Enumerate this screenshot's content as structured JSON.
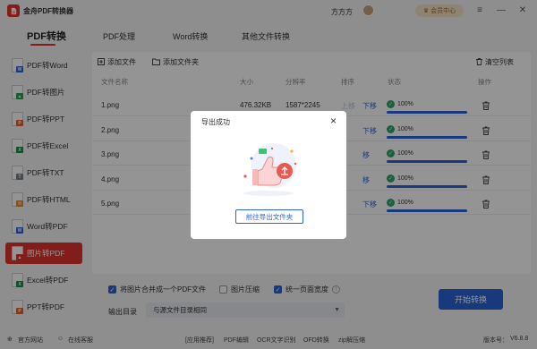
{
  "app": {
    "title": "金舟PDF转换器",
    "username": "方方方",
    "vip_label": "会员中心",
    "version_label": "版本号：",
    "version": "V6.8.8"
  },
  "nav": {
    "tabs": [
      "PDF转换",
      "PDF处理",
      "Word转换",
      "其他文件转换"
    ]
  },
  "sidebar": {
    "items": [
      {
        "label": "PDF转Word",
        "badge": "W",
        "color": "#2a64d8"
      },
      {
        "label": "PDF转图片",
        "badge": "▲",
        "color": "#26a05a"
      },
      {
        "label": "PDF转PPT",
        "badge": "P",
        "color": "#e0612b"
      },
      {
        "label": "PDF转Excel",
        "badge": "X",
        "color": "#1e8a4c"
      },
      {
        "label": "PDF转TXT",
        "badge": "T",
        "color": "#7a7f8c"
      },
      {
        "label": "PDF转HTML",
        "badge": "H",
        "color": "#e08a2b"
      },
      {
        "label": "Word转PDF",
        "badge": "W",
        "color": "#2a64d8"
      },
      {
        "label": "图片转PDF",
        "badge": "▲",
        "color": "#ffffff"
      },
      {
        "label": "Excel转PDF",
        "badge": "X",
        "color": "#1e8a4c"
      },
      {
        "label": "PPT转PDF",
        "badge": "P",
        "color": "#e0612b"
      }
    ],
    "active_index": 7
  },
  "toolbar": {
    "add_file": "添加文件",
    "add_folder": "添加文件夹",
    "clear_list": "清空列表"
  },
  "table": {
    "headers": {
      "name": "文件名称",
      "size": "大小",
      "resolution": "分辨率",
      "order": "排序",
      "status": "状态",
      "action": "操作"
    },
    "rows": [
      {
        "name": "1.png",
        "size": "476.32KB",
        "resolution": "1587*2245",
        "up": "上移",
        "down": "下移",
        "progress": "100%",
        "fill": 1.0
      },
      {
        "name": "2.png",
        "size": "",
        "resolution": "",
        "up": "",
        "down": "下移",
        "progress": "100%",
        "fill": 1.0
      },
      {
        "name": "3.png",
        "size": "",
        "resolution": "",
        "up": "",
        "down": "移",
        "progress": "100%",
        "fill": 1.0
      },
      {
        "name": "4.png",
        "size": "",
        "resolution": "",
        "up": "",
        "down": "移",
        "progress": "100%",
        "fill": 1.0
      },
      {
        "name": "5.png",
        "size": "",
        "resolution": "",
        "up": "",
        "down": "下移",
        "progress": "100%",
        "fill": 1.0
      }
    ]
  },
  "options": {
    "merge": "将图片合并成一个PDF文件",
    "compress": "图片压缩",
    "uniform_width": "统一页面宽度"
  },
  "output": {
    "label": "输出目录",
    "value": "与源文件目录相同"
  },
  "start_button": "开始转换",
  "statusbar": {
    "website": "官方网站",
    "service": "在线客服",
    "app_rec": "[应用推荐]",
    "links": [
      "PDF编辑",
      "OCR文字识别",
      "OFD转换",
      "zip解压缩"
    ]
  },
  "dialog": {
    "title": "导出成功",
    "button": "前往导出文件夹"
  },
  "colors": {
    "brand": "#e0352b",
    "accent": "#2a64d8",
    "success": "#2fa46b"
  }
}
